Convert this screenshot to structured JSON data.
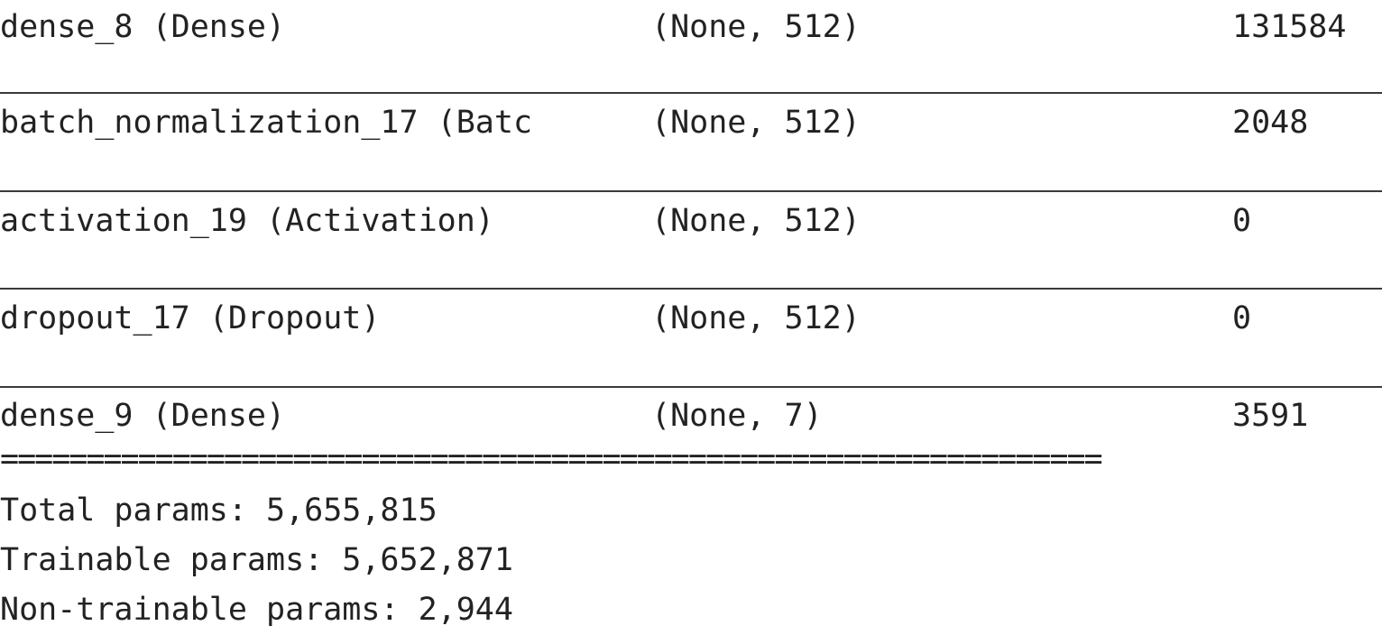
{
  "layers": [
    {
      "name": "dense_8 (Dense)",
      "output_shape": "(None, 512)",
      "params": "131584"
    },
    {
      "name": "batch_normalization_17 (Batc",
      "output_shape": "(None, 512)",
      "params": "2048"
    },
    {
      "name": "activation_19 (Activation)",
      "output_shape": "(None, 512)",
      "params": "0"
    },
    {
      "name": "dropout_17 (Dropout)",
      "output_shape": "(None, 512)",
      "params": "0"
    },
    {
      "name": "dense_9 (Dense)",
      "output_shape": "(None, 7)",
      "params": "3591"
    }
  ],
  "separator": "================================================================",
  "totals": {
    "total": "Total params: 5,655,815",
    "trainable": "Trainable params: 5,652,871",
    "non_trainable": "Non-trainable params: 2,944"
  }
}
